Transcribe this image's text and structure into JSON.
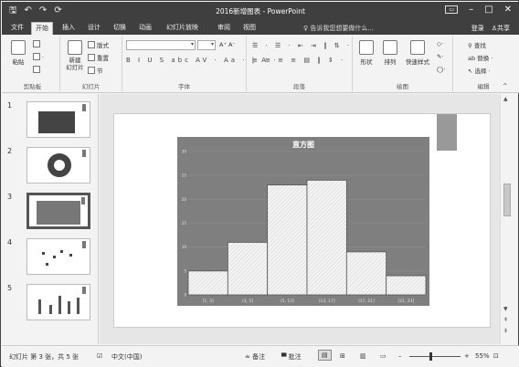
{
  "window": {
    "title": "2016新增图表 - PowerPoint",
    "qat": [
      "🖫",
      "↶",
      "↷",
      "⟳"
    ]
  },
  "tabs": [
    "文件",
    "开始",
    "插入",
    "设计",
    "切换",
    "动画",
    "幻灯片放映",
    "审阅",
    "视图"
  ],
  "active_tab": "开始",
  "tell_me": "告诉我您想要做什么...",
  "account": {
    "login": "登录",
    "share": "共享"
  },
  "ribbon": {
    "clipboard": {
      "label": "剪贴板",
      "paste": "粘贴"
    },
    "slides": {
      "label": "幻灯片",
      "new_slide": "新建\n幻灯片",
      "layout": "版式",
      "reset": "重置",
      "section": "节"
    },
    "font": {
      "label": "字体",
      "bold": "B",
      "italic": "I",
      "underline": "U",
      "strike": "S",
      "format_row": "B I U S abc AV · Aa · | A ·",
      "grow": "A⁺ A⁻"
    },
    "paragraph": {
      "label": "段落"
    },
    "drawing": {
      "label": "绘图",
      "shapes": "形状",
      "arrange": "排列",
      "quick_styles": "快速样式"
    },
    "editing": {
      "label": "编辑",
      "find": "查找",
      "replace": "替换",
      "select": "选择"
    }
  },
  "thumbnails": [
    {
      "num": "1"
    },
    {
      "num": "2"
    },
    {
      "num": "3"
    },
    {
      "num": "4"
    },
    {
      "num": "5"
    }
  ],
  "status": {
    "slide_info": "幻灯片 第 3 张，共 5 张",
    "language": "中文(中国)",
    "notes": "备注",
    "comments": "批注",
    "zoom": "55%"
  },
  "chart_data": {
    "type": "bar",
    "title": "直方图",
    "categories": [
      "[1, 3]",
      "(3, 5]",
      "(5, 13]",
      "(13, 17]",
      "(17, 21]",
      "(21, 23]"
    ],
    "values": [
      5,
      11,
      23,
      24,
      9,
      4
    ],
    "ylim": [
      0,
      30
    ],
    "yticks": [
      0,
      5,
      10,
      15,
      20,
      25,
      30
    ],
    "xlabel": "",
    "ylabel": ""
  }
}
